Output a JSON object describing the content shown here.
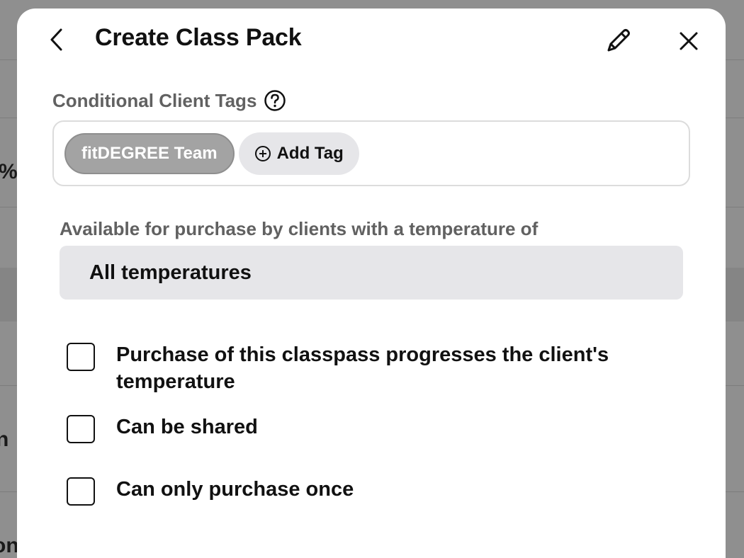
{
  "background": {
    "fragments": [
      "%",
      "n",
      "on"
    ]
  },
  "modal": {
    "title": "Create Class Pack",
    "icons": {
      "back": "chevron-left-icon",
      "edit": "pencil-icon",
      "close": "close-icon",
      "help": "question-circle-icon",
      "add": "plus-circle-icon"
    },
    "tags": {
      "label": "Conditional Client Tags",
      "chips": [
        "fitDEGREE Team"
      ],
      "add_label": "Add Tag"
    },
    "temperature": {
      "label": "Available for purchase by clients with a temperature of",
      "selected": "All temperatures"
    },
    "options": [
      {
        "label": "Purchase of this classpass progresses the client's temperature",
        "checked": false
      },
      {
        "label": "Can be shared",
        "checked": false
      },
      {
        "label": "Can only purchase once",
        "checked": false
      }
    ]
  },
  "colors": {
    "overlay": "#8f8f8f",
    "modal_bg": "#ffffff",
    "chip_bg": "#a3a3a3",
    "field_bg": "#e6e6e9",
    "label_text": "#616161",
    "text": "#111111"
  }
}
